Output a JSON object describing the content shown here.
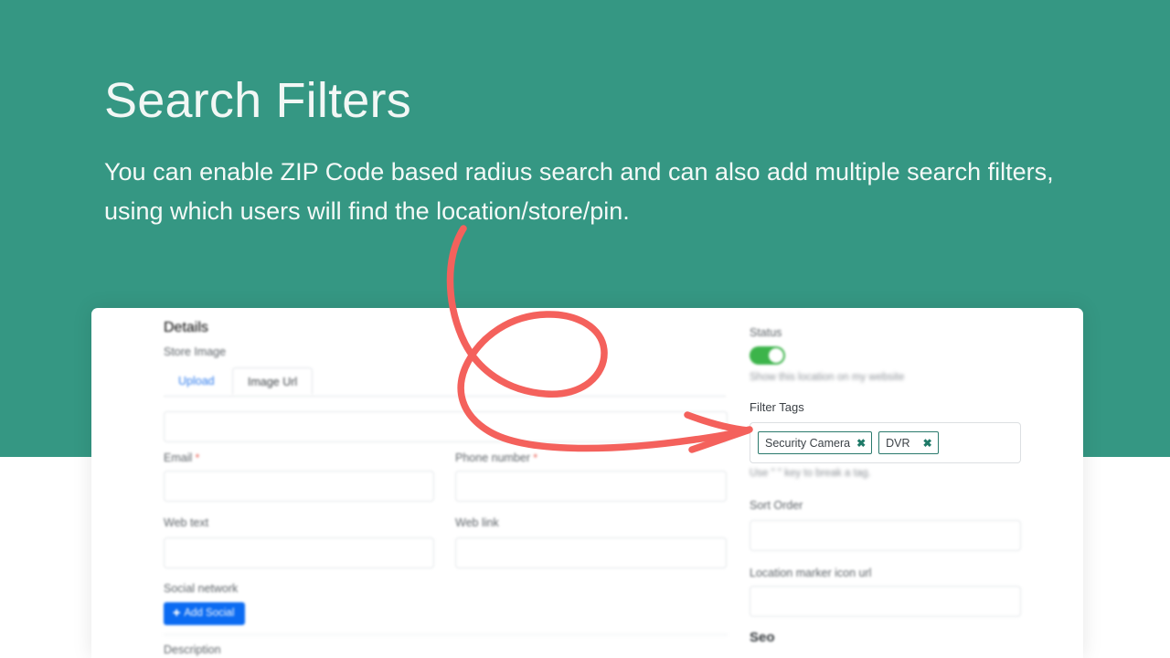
{
  "slide": {
    "title": "Search Filters",
    "subtitle": "You can enable ZIP Code based radius search and can also add multiple search filters, using which users will find the location/store/pin.",
    "band_color": "#359783",
    "title_color": "#f2f7f5",
    "annotation_color": "#f4615c"
  },
  "app": {
    "details": {
      "section_title": "Details",
      "store_image_label": "Store Image",
      "tabs": [
        {
          "label": "Upload",
          "active": false
        },
        {
          "label": "Image Url",
          "active": true
        }
      ],
      "image_url_value": "",
      "fields": [
        {
          "label": "Email",
          "required": true,
          "value": ""
        },
        {
          "label": "Phone number",
          "required": true,
          "value": ""
        },
        {
          "label": "Web text",
          "required": false,
          "value": ""
        },
        {
          "label": "Web link",
          "required": false,
          "value": ""
        }
      ],
      "social_network_label": "Social network",
      "add_social_label": "Add Social",
      "description_label": "Description"
    },
    "sidebar": {
      "status_label": "Status",
      "status_enabled": true,
      "status_hint": "Show this location on my website",
      "filter_tags_label": "Filter Tags",
      "tags": [
        {
          "label": "Security Camera",
          "remove": "✖"
        },
        {
          "label": "DVR",
          "remove": "✖"
        }
      ],
      "tag_hint": "Use \" \" key to break a tag.",
      "sort_order_label": "Sort Order",
      "sort_order_value": "",
      "marker_icon_label": "Location marker icon url",
      "marker_icon_value": "",
      "seo_section_title": "Seo"
    }
  }
}
